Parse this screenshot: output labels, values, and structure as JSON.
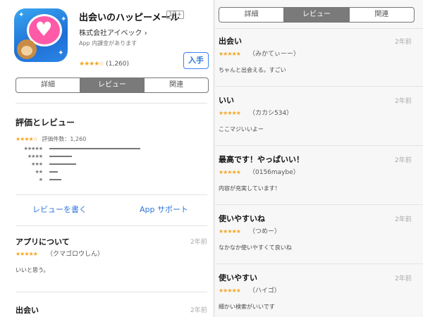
{
  "app": {
    "title": "出会いのハッピーメール",
    "age_rating": "17+",
    "developer": "株式会社アイベック",
    "developer_chevron": "›",
    "iap_note": "App 内課金があります",
    "rating_stars": "★★★★☆",
    "rating_count": "(1,260)",
    "get_button": "入手"
  },
  "tabs": [
    {
      "label": "詳細"
    },
    {
      "label": "レビュー"
    },
    {
      "label": "関連"
    }
  ],
  "ratings": {
    "section_title": "評価とレビュー",
    "summary_stars": "★★★★☆",
    "summary_text": "評価件数：1,260",
    "histogram": [
      {
        "stars": "★★★★★",
        "fraction": 0.86
      },
      {
        "stars": "★★★★",
        "fraction": 0.21
      },
      {
        "stars": "★★★",
        "fraction": 0.25
      },
      {
        "stars": "★★",
        "fraction": 0.08
      },
      {
        "stars": "★",
        "fraction": 0.11
      }
    ]
  },
  "links": {
    "write_review": "レビューを書く",
    "app_support": "App サポート"
  },
  "left_reviews": [
    {
      "title": "アプリについて",
      "stars": "★★★★★",
      "author": "（クマゴロウしん）",
      "date": "2年前",
      "body": "いいと思う。"
    },
    {
      "title": "出会い",
      "stars": "",
      "author": "",
      "date": "2年前",
      "body": ""
    }
  ],
  "right_reviews": [
    {
      "title": "出会い",
      "stars": "★★★★★",
      "author": "（みかてぃーー）",
      "date": "2年前",
      "body": "ちゃんと出会える。すごい"
    },
    {
      "title": "いい",
      "stars": "★★★★★",
      "author": "（カカシ534）",
      "date": "2年前",
      "body": "ここマジいいよー"
    },
    {
      "title": "最高です！やっぱいい！",
      "stars": "★★★★★",
      "author": "（0156maybe）",
      "date": "2年前",
      "body": "内容が充実しています！"
    },
    {
      "title": "使いやすいね",
      "stars": "★★★★★",
      "author": "（つめー）",
      "date": "2年前",
      "body": "なかなか使いやすくて良いね"
    },
    {
      "title": "使いやすい",
      "stars": "★★★★★",
      "author": "（ハイゴ）",
      "date": "2年前",
      "body": "細かい検索がいいです"
    }
  ],
  "colors": {
    "accent": "#2f76d8",
    "star": "#f5a623",
    "segment_active": "#7a7a7a"
  }
}
